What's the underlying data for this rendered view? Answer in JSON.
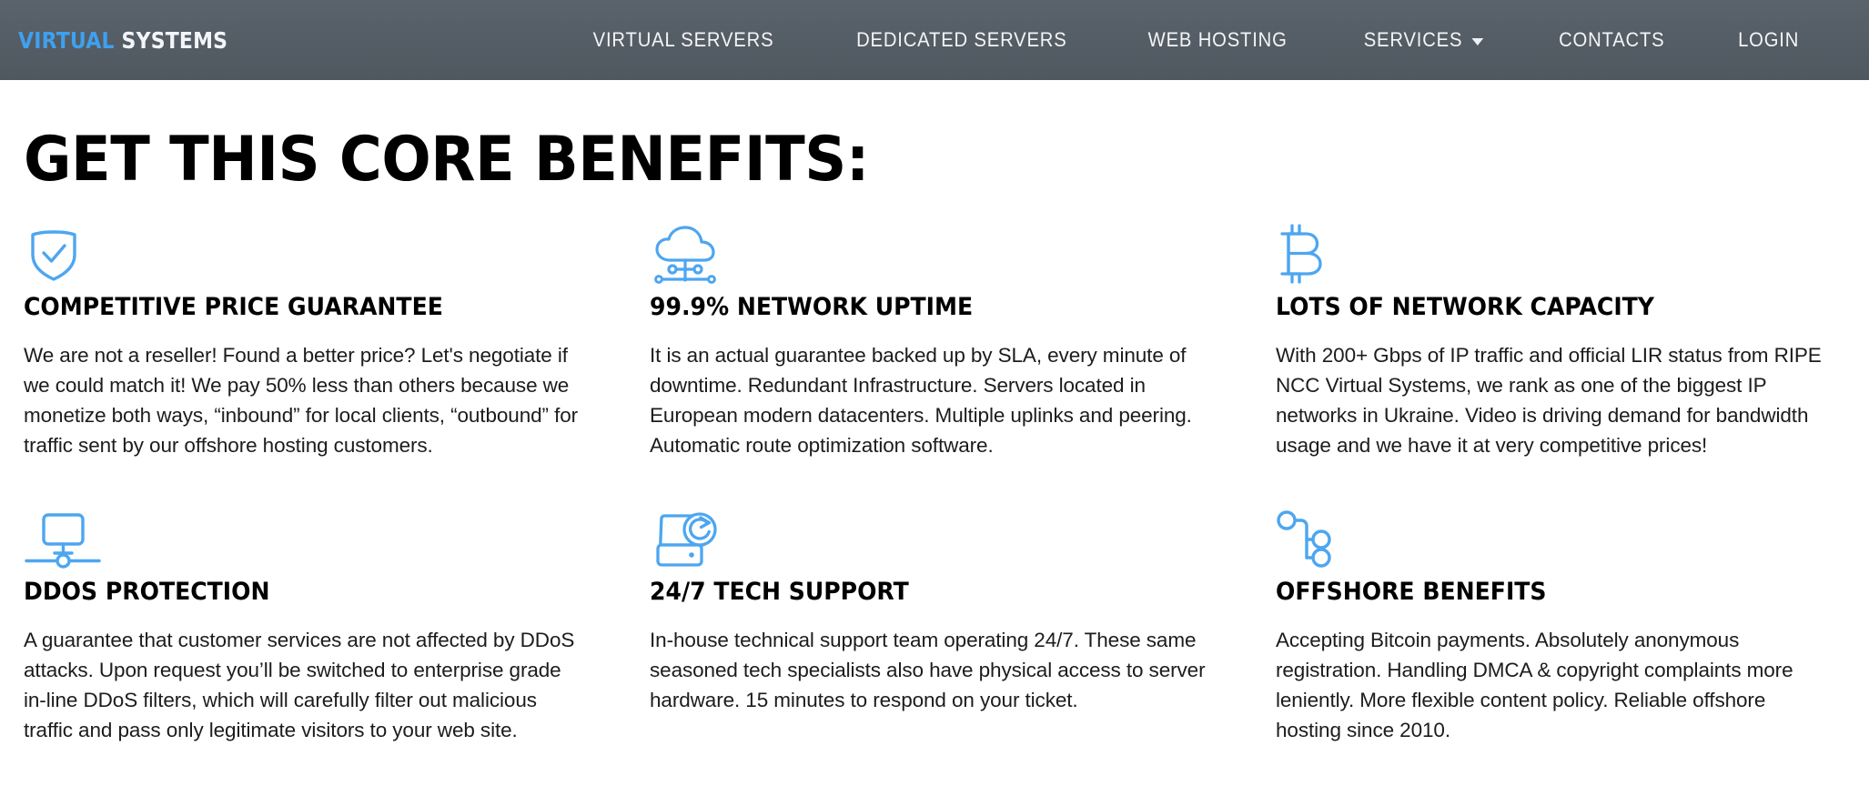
{
  "header": {
    "brand": {
      "part1": "VIRTUAL",
      "part2": "SYSTEMS"
    },
    "nav": [
      {
        "label": "VIRTUAL SERVERS",
        "has_dropdown": false
      },
      {
        "label": "DEDICATED SERVERS",
        "has_dropdown": false
      },
      {
        "label": "WEB HOSTING",
        "has_dropdown": false
      },
      {
        "label": "SERVICES",
        "has_dropdown": true
      },
      {
        "label": "CONTACTS",
        "has_dropdown": false
      },
      {
        "label": "LOGIN",
        "has_dropdown": false
      }
    ],
    "background_color": "#555e66",
    "brand_accent_color": "#3fa0ef"
  },
  "main": {
    "page_title": "GET THIS CORE BENEFITS:",
    "icon_color": "#4da6f0",
    "benefits": [
      {
        "icon": "shield-check-icon",
        "title": "COMPETITIVE PRICE GUARANTEE",
        "text": "We are not a reseller! Found a better price? Let's negotiate if we could match it! We pay 50% less than others because we monetize both ways, “inbound” for local clients, “outbound” for traffic sent by our offshore hosting customers."
      },
      {
        "icon": "cloud-network-icon",
        "title": "99.9% NETWORK UPTIME",
        "text": "It is an actual guarantee backed up by SLA, every minute of downtime. Redundant Infrastructure. Servers located in European modern datacenters. Multiple uplinks and peering. Automatic route optimization software."
      },
      {
        "icon": "bitcoin-icon",
        "title": "LOTS OF NETWORK CAPACITY",
        "text": "With 200+ Gbps of IP traffic and official LIR status from RIPE NCC Virtual Systems, we rank as one of the biggest IP networks in Ukraine. Video is driving demand for bandwidth usage and we have it at very competitive prices!"
      },
      {
        "icon": "monitor-network-icon",
        "title": "DDOS PROTECTION",
        "text": "A guarantee that customer services are not affected by DDoS attacks. Upon request you’ll be switched to enterprise grade in-line DDoS filters, which will carefully filter out malicious traffic and pass only legitimate visitors to your web site."
      },
      {
        "icon": "server-refresh-icon",
        "title": "24/7 TECH SUPPORT",
        "text": "In-house technical support team operating 24/7. These same seasoned tech specialists also have physical access to server hardware. 15 minutes to respond on your ticket."
      },
      {
        "icon": "node-tree-icon",
        "title": "OFFSHORE BENEFITS",
        "text": "Accepting Bitcoin payments. Absolutely anonymous registration. Handling DMCA & copyright complaints more leniently. More flexible content policy. Reliable offshore hosting since 2010."
      }
    ]
  }
}
